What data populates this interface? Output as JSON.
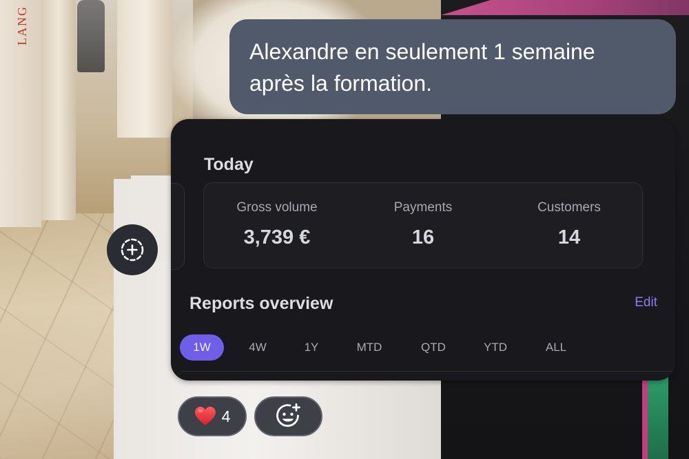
{
  "background": {
    "brand_text": "LANG"
  },
  "message": {
    "line1": "Alexandre en seulement 1 semaine",
    "line2": "après la formation."
  },
  "dashboard": {
    "today_title": "Today",
    "stats": [
      {
        "label": "Gross volume",
        "value": "3,739 €"
      },
      {
        "label": "Payments",
        "value": "16"
      },
      {
        "label": "Customers",
        "value": "14"
      }
    ],
    "reports_title": "Reports overview",
    "edit_label": "Edit",
    "periods": [
      "1W",
      "4W",
      "1Y",
      "MTD",
      "QTD",
      "YTD",
      "ALL"
    ],
    "active_period": "1W",
    "accent_color": "#6f5ee8"
  },
  "reactions": {
    "heart_emoji": "❤️",
    "heart_count": "4",
    "add_reaction_icon": "add-emoji-icon",
    "add_media_icon": "dashed-circle-plus-icon"
  }
}
